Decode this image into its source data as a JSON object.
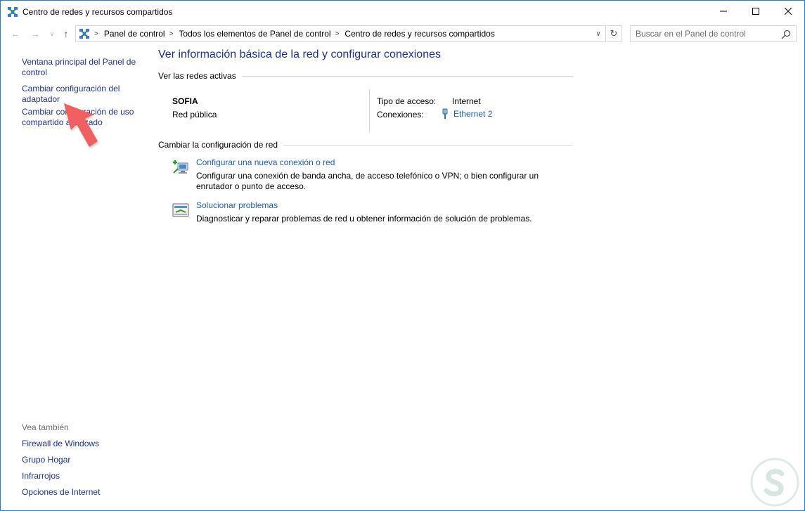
{
  "window": {
    "title": "Centro de redes y recursos compartidos",
    "controls": {
      "minimize": "—",
      "maximize": "☐",
      "close": "✕"
    }
  },
  "navigation": {
    "breadcrumb": [
      "Panel de control",
      "Todos los elementos de Panel de control",
      "Centro de redes y recursos compartidos"
    ],
    "search_placeholder": "Buscar en el Panel de control"
  },
  "left_pane": {
    "links": [
      "Ventana principal del Panel de control",
      "Cambiar configuración del adaptador",
      "Cambiar configuración de uso compartido avanzado"
    ],
    "see_also": {
      "heading": "Vea también",
      "links": [
        "Firewall de Windows",
        "Grupo Hogar",
        "Infrarrojos",
        "Opciones de Internet"
      ]
    }
  },
  "main": {
    "title": "Ver información básica de la red y configurar conexiones",
    "active_networks": {
      "heading": "Ver las redes activas",
      "network_name": "SOFIA",
      "network_type": "Red pública",
      "access_type_label": "Tipo de acceso:",
      "access_type_value": "Internet",
      "connections_label": "Conexiones:",
      "connections_value": "Ethernet 2"
    },
    "change_settings": {
      "heading": "Cambiar la configuración de red",
      "tasks": [
        {
          "icon": "new-connection-icon",
          "link": "Configurar una nueva conexión o red",
          "description": "Configurar una conexión de banda ancha, de acceso telefónico o VPN; o bien configurar un enrutador o punto de acceso."
        },
        {
          "icon": "troubleshoot-icon",
          "link": "Solucionar problemas",
          "description": "Diagnosticar y reparar problemas de red u obtener información de solución de problemas."
        }
      ]
    }
  },
  "colors": {
    "link": "#1e3287",
    "task_link": "#1e5fb4",
    "arrow": "#f04e4e",
    "border": "#2b79c9"
  }
}
